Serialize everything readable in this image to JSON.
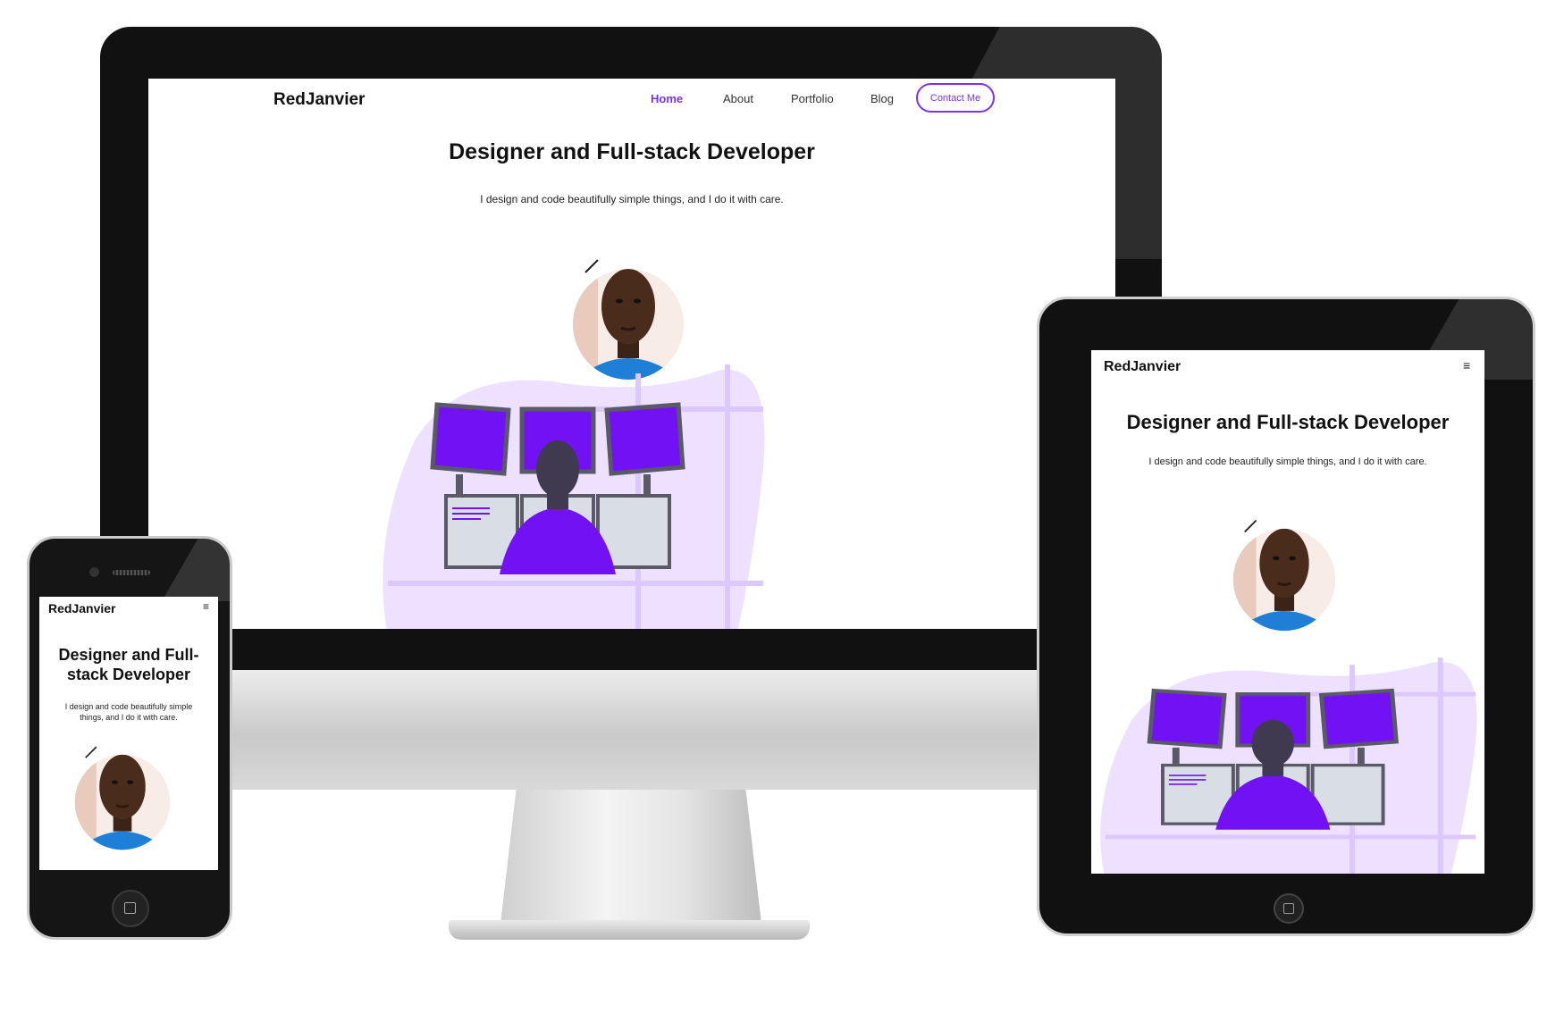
{
  "site": {
    "brand": "RedJanvier",
    "nav": [
      "Home",
      "About",
      "Portfolio",
      "Blog"
    ],
    "contact_label": "Contact Me",
    "headline": "Designer and Full-stack Developer",
    "phone_headline_line1": "Designer and Full-",
    "phone_headline_line2": "stack Developer",
    "tagline": "I design and code beautifully simple things, and I do it with care.",
    "phone_tagline_line1": "I design and code beautifully simple",
    "phone_tagline_line2": "things, and I do it with care.",
    "menu_glyph": "≡"
  },
  "colors": {
    "accent": "#7b2ff7",
    "blob": "#ede1ff",
    "monitor_purple": "#7311f5",
    "shirt_blue": "#1f7fd6"
  },
  "icons": [
    "hamburger-menu-icon",
    "avatar-photo",
    "developer-illustration"
  ]
}
